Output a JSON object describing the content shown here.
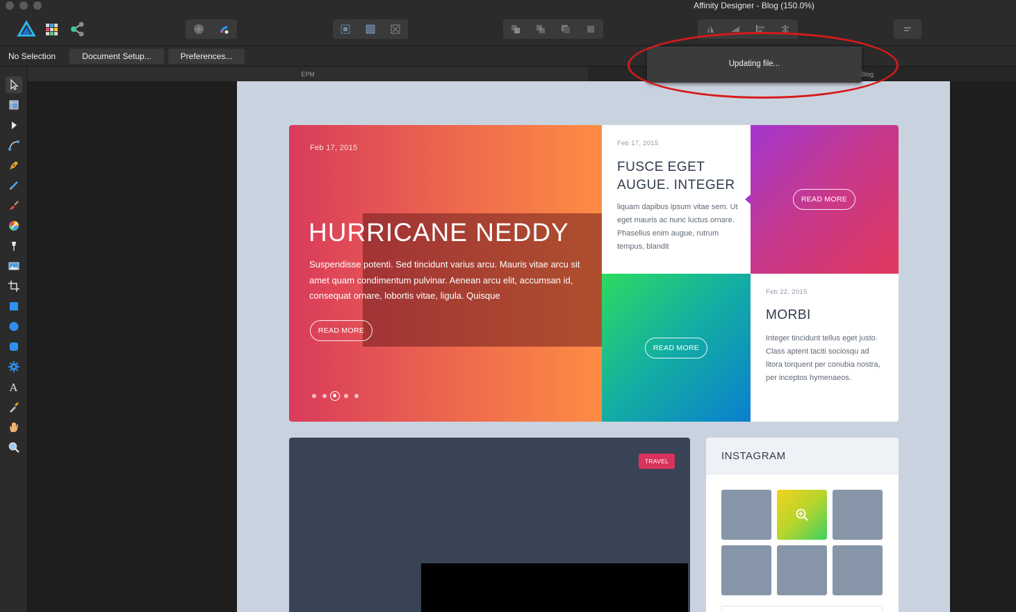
{
  "window": {
    "title": "Affinity Designer - Blog (150.0%)"
  },
  "context_bar": {
    "status": "No Selection",
    "document_setup_label": "Document Setup...",
    "preferences_label": "Preferences..."
  },
  "tabs": [
    {
      "label": "EPM"
    },
    {
      "label": "Blog"
    }
  ],
  "popup": {
    "message": "Updating file..."
  },
  "icons": {
    "personas": [
      "designer-persona-icon",
      "pixel-persona-icon",
      "export-persona-icon"
    ],
    "tools": [
      "move-icon",
      "artboard-icon",
      "node-icon",
      "corner-icon",
      "pen-icon",
      "pencil-icon",
      "brush-icon",
      "fill-icon",
      "transparency-icon",
      "image-icon",
      "crop-icon",
      "rectangle-icon",
      "ellipse-icon",
      "rounded-rectangle-icon",
      "cog-shape-icon",
      "text-icon",
      "eyedropper-icon",
      "hand-icon",
      "zoom-icon"
    ]
  },
  "colors": {
    "highlight": "#d71a1a",
    "hero_start": "#d93b5b",
    "hero_end": "#fd8c44",
    "purple": "#a337cd",
    "green": "#2cdb60",
    "blue": "#0a7fd0",
    "travel_badge": "#d8335a"
  },
  "artboard": {
    "hero": {
      "date": "Feb 17, 2015",
      "title": "HURRICANE NEDDY",
      "text": "Suspendisse potenti. Sed tincidunt varius arcu. Mauris vitae arcu sit amet quam condimentum pulvinar. Aenean arcu elit, accumsan id, consequat ornare, lobortis vitae, ligula. Quisque",
      "button": "READ MORE",
      "slide_count": 5,
      "active_slide": 3
    },
    "post1": {
      "date": "Feb 17, 2015",
      "title_line1": "FUSCE EGET",
      "title_line2": "AUGUE. INTEGER",
      "text": "liquam dapibus ipsum vitae sem. Ut eget mauris ac nunc luctus ornare. Phasellus enim augue, rutrum tempus, blandit",
      "button": "READ MORE"
    },
    "post2": {
      "date": "Feb 22, 2015",
      "title": "MORBI",
      "text": "Integer tincidunt tellus eget justo. Class aptent taciti sociosqu ad litora torquent per conubia nostra, per inceptos hymenaeos.",
      "button": "READ MORE"
    },
    "video": {
      "badge": "TRAVEL"
    },
    "instagram": {
      "title": "INSTAGRAM"
    }
  }
}
